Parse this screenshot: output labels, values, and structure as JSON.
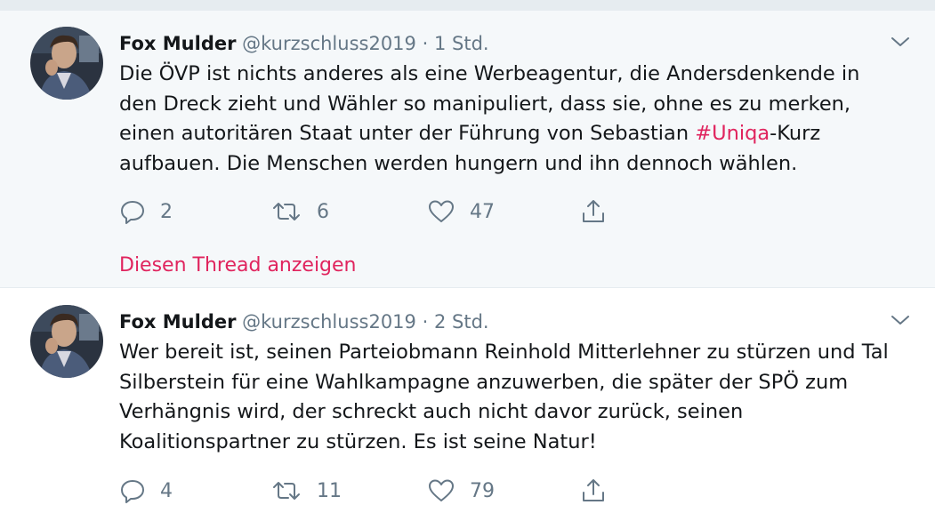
{
  "tweets": [
    {
      "author_name": "Fox Mulder",
      "handle": "@kurzschluss2019",
      "separator": "·",
      "time": "1 Std.",
      "text_before": "Die ÖVP ist nichts anderes als eine Werbeagentur, die Andersdenkende in\nden Dreck zieht und Wähler so manipuliert, dass sie, ohne es zu merken,\neinen autoritären Staat unter der Führung von Sebastian ",
      "hashtag": "#Uniqa",
      "text_after": "-Kurz\naufbauen. Die Menschen werden hungern und ihn dennoch wählen.",
      "replies": "2",
      "retweets": "6",
      "likes": "47",
      "thread_link": "Diesen Thread anzeigen"
    },
    {
      "author_name": "Fox Mulder",
      "handle": "@kurzschluss2019",
      "separator": "·",
      "time": "2 Std.",
      "text": "Wer bereit ist, seinen Parteiobmann Reinhold Mitterlehner zu stürzen und Tal\nSilberstein für eine Wahlkampagne anzuwerben, die später der SPÖ zum\nVerhängnis wird, der schreckt auch nicht davor zurück, seinen\nKoalitionspartner zu stürzen. Es ist seine Natur!",
      "replies": "4",
      "retweets": "11",
      "likes": "79"
    }
  ],
  "icons": {
    "reply": "reply-icon",
    "retweet": "retweet-icon",
    "like": "like-icon",
    "share": "share-icon",
    "menu": "chevron-down-icon"
  },
  "colors": {
    "hashtag": "#e0245e",
    "link": "#e0245e",
    "secondary_text": "#657786",
    "highlight_background": "#f5f8fa"
  }
}
